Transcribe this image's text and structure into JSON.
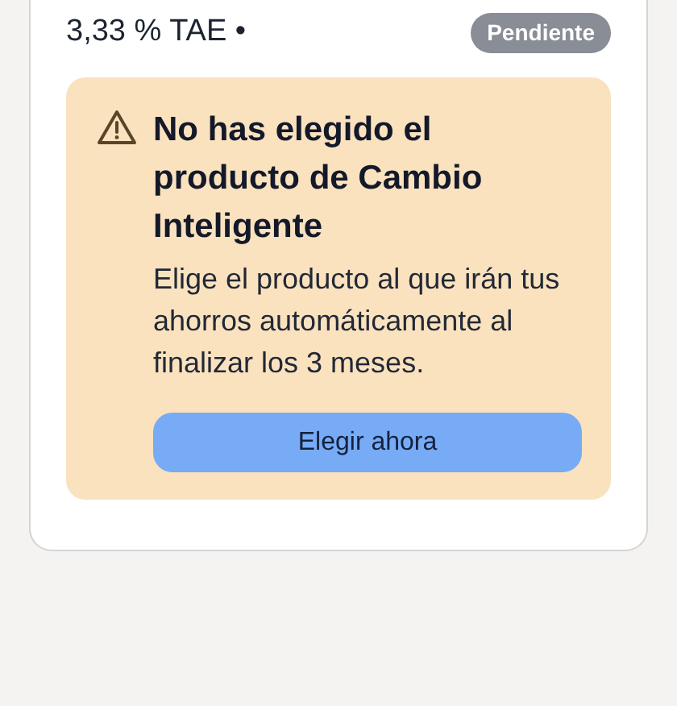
{
  "rate": "3,33 % TAE •",
  "status_badge": "Pendiente",
  "alert": {
    "title": "No has elegido el producto de Cambio Inteligente",
    "message": "Elige el producto al que irán tus ahorros automáticamente al finalizar los 3 meses.",
    "button": "Elegir ahora"
  }
}
